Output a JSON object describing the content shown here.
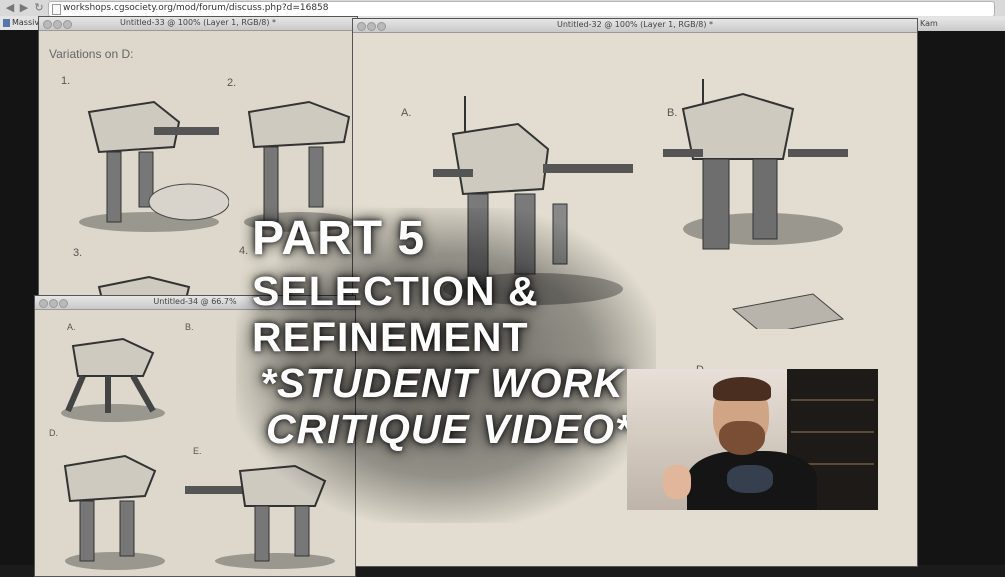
{
  "browser": {
    "url": "workshops.cgsociety.org/mod/forum/discuss.php?d=16858",
    "bookmark": "Massiv"
  },
  "windows": {
    "doc33": {
      "title": "Untitled-33 @ 100% (Layer 1, RGB/8) *",
      "heading": "Variations on D:",
      "labels": [
        "1.",
        "2.",
        "3.",
        "4."
      ]
    },
    "doc34": {
      "title": "Untitled-34 @ 66.7%",
      "labels": [
        "A.",
        "B.",
        "D.",
        "E."
      ]
    },
    "doc32": {
      "title": "Untitled-32 @ 100% (Layer 1, RGB/8) *",
      "labels": [
        "A.",
        "B.",
        "D."
      ]
    },
    "side_title": "Kam"
  },
  "overlay": {
    "line1": "PART 5",
    "line2": "SELECTION &",
    "line3": "REFINEMENT",
    "line4": "*STUDENT WORK",
    "line5": "CRITIQUE VIDEO*"
  },
  "colors": {
    "paper": "#ddd8cb",
    "ink": "#3a3a3a",
    "shadow": "#8c8a85"
  }
}
